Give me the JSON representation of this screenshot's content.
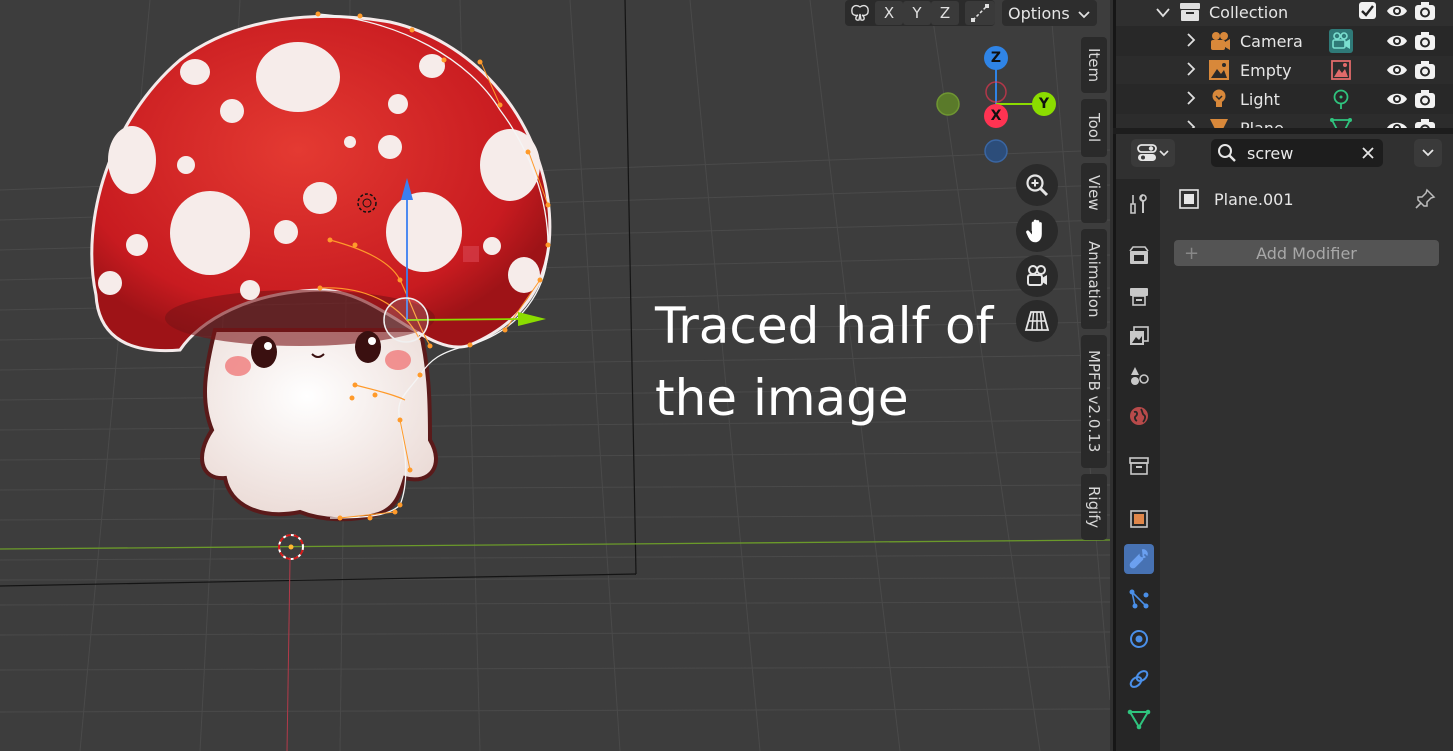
{
  "viewport": {
    "header": {
      "toggle_x": "X",
      "toggle_y": "Y",
      "toggle_z": "Z",
      "options_label": "Options"
    },
    "gizmo": {
      "axis_x": "X",
      "axis_y": "Y",
      "axis_z": "Z"
    },
    "nav_buttons": [
      "zoom-icon",
      "pan-hand-icon",
      "camera-icon",
      "grid-icon"
    ],
    "overlay_text": {
      "line1": "Traced half of",
      "line2": "the image"
    },
    "sidebar_tabs": [
      "Item",
      "Tool",
      "View",
      "Animation",
      "MPFB v2.0.13",
      "Rigify"
    ]
  },
  "outliner": {
    "collection": "Collection",
    "objects": [
      {
        "name": "Camera",
        "data_icon": "camera-data-icon"
      },
      {
        "name": "Empty",
        "data_icon": "image-data-icon"
      },
      {
        "name": "Light",
        "data_icon": "light-data-icon"
      },
      {
        "name": "Plane",
        "data_icon": "mesh-data-icon"
      }
    ]
  },
  "properties": {
    "search_value": "screw",
    "object_name": "Plane.001",
    "add_modifier_label": "Add Modifier",
    "tabs": [
      "tool",
      "render",
      "output",
      "view-layer",
      "scene",
      "world",
      "collection",
      "object",
      "modifiers",
      "particles",
      "physics",
      "constraints",
      "object-data"
    ],
    "active_tab": "modifiers"
  },
  "colors": {
    "axis_x": "#ff3352",
    "axis_y": "#8bdc00",
    "axis_z": "#2f84e6",
    "active_tab": "#4772b3",
    "mushroom_cap": "#d21f24"
  }
}
